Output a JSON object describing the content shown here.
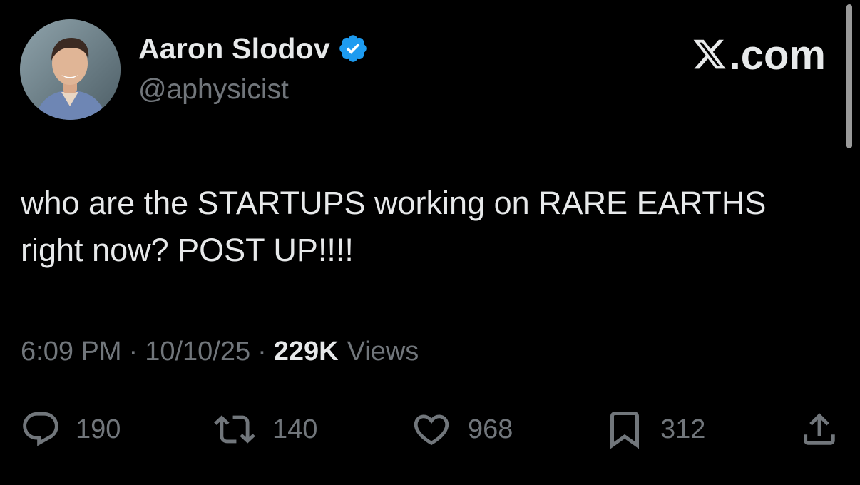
{
  "author": {
    "display_name": "Aaron Slodov",
    "handle": "@aphysicist",
    "verified": true
  },
  "brand": {
    "label": ".com",
    "icon": "x-logo-icon"
  },
  "tweet": {
    "text": "who are the STARTUPS working on RARE EARTHS right now? POST UP!!!!"
  },
  "meta": {
    "time": "6:09 PM",
    "separator": "·",
    "date": "10/10/25",
    "views_count": "229K",
    "views_label": "Views"
  },
  "actions": {
    "replies": "190",
    "reposts": "140",
    "likes": "968",
    "bookmarks": "312"
  },
  "colors": {
    "background": "#000000",
    "primary_text": "#e7e9ea",
    "secondary_text": "#71767b",
    "verified_blue": "#1d9bf0"
  }
}
